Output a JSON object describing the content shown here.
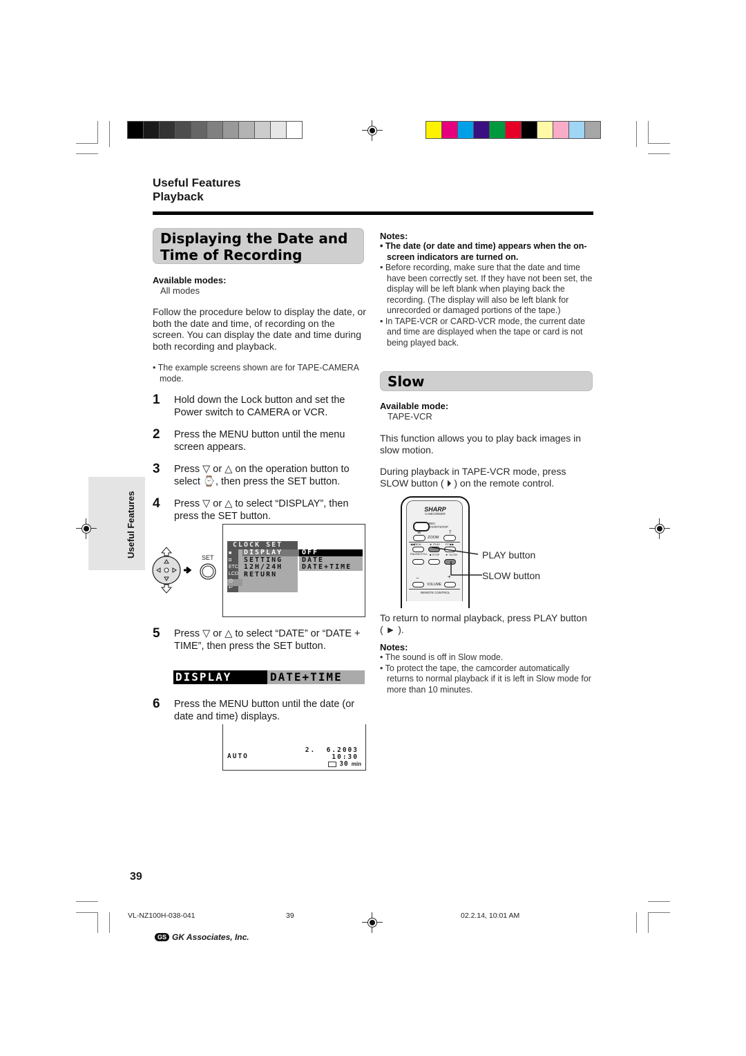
{
  "header": {
    "grayscale_swatches": [
      "#000000",
      "#1a1a1a",
      "#333333",
      "#4d4d4d",
      "#666666",
      "#808080",
      "#999999",
      "#b3b3b3",
      "#cccccc",
      "#e6e6e6",
      "#ffffff"
    ],
    "color_swatches": [
      "#fff200",
      "#e6007e",
      "#00a0e9",
      "#3a0f82",
      "#009a3e",
      "#e60027",
      "#000000",
      "#fff9a8",
      "#f7adc8",
      "#9fd5f5",
      "#a6a6a6"
    ]
  },
  "breadcrumb": {
    "line1": "Useful Features",
    "line2": "Playback"
  },
  "section1": {
    "title_line1": "Displaying the Date and",
    "title_line2": "Time of Recording",
    "available_label": "Available modes:",
    "available_value": "All modes",
    "intro": "Follow the procedure below to display the date, or both the date and time, of recording on the screen. You can display the date and time during both recording and playback.",
    "note": "• The example screens shown are for TAPE-CAMERA mode.",
    "steps": [
      {
        "num": "1",
        "text": "Hold down the Lock button and set the Power switch to CAMERA or VCR."
      },
      {
        "num": "2",
        "text": "Press the MENU button until the menu screen appears."
      },
      {
        "num": "3",
        "text": "Press ▽ or △ on the operation button to select ⌚, then press the SET button."
      },
      {
        "num": "4",
        "text": "Press ▽ or △ to select “DISPLAY”, then press the SET button."
      },
      {
        "num": "5",
        "text": "Press ▽ or △ to select “DATE” or “DATE + TIME”, then press the SET button."
      },
      {
        "num": "6",
        "text": "Press the MENU button until the date (or date and time) displays."
      }
    ],
    "set_label": "SET",
    "menu_screen": {
      "header": "CLOCK SET",
      "side_icons": [
        "camera-icon",
        "card-camera-icon",
        "ETC",
        "LCD",
        "clock-icon",
        "return-icon"
      ],
      "items": [
        "DISPLAY",
        "SETTING",
        "12H/24H",
        "RETURN"
      ],
      "options": [
        "OFF",
        "DATE",
        "DATE+TIME"
      ],
      "selected_option": "OFF"
    },
    "display_bar": {
      "left": "DISPLAY",
      "right": "DATE+TIME"
    },
    "playback_screen": {
      "mode": "AUTO",
      "date": "2.  6.2003",
      "time": "10:30",
      "remaining": "30",
      "remaining_unit": "min"
    }
  },
  "section2_notes": {
    "label": "Notes:",
    "items": [
      "The date (or date and time) appears when the on-screen indicators are turned on.",
      "Before recording, make sure that the date and time have been correctly set. If they have not been set, the display will be left blank when playing back the recording. (The display will also be left blank for unrecorded or damaged portions of the tape.)",
      "In TAPE-VCR or CARD-VCR mode, the current date and time are displayed when the tape or card is not being played back."
    ]
  },
  "slow": {
    "title": "Slow",
    "available_label": "Available mode:",
    "available_value": "TAPE-VCR",
    "intro": "This function allows you to play back images in slow motion.",
    "instruction": "During playback in TAPE-VCR mode, press SLOW button ( ⏵ ) on the remote control.",
    "remote": {
      "brand": "SHARP",
      "model": "CAMCORDER",
      "rec": "REC START/STOP",
      "w": "W",
      "t": "T",
      "zoom": "ZOOM",
      "rew": "◀◀REW",
      "play": "► PLAY",
      "ff": "FF ▶▶",
      "pause": "PAUSE/STILL",
      "stop": "■ STOP",
      "slow": "► SLOW",
      "minus": "−",
      "plus": "+",
      "volume": "VOLUME",
      "footer": "REMOTE CONTROL"
    },
    "play_callout": "PLAY button",
    "slow_callout": "SLOW button",
    "return_text": "To return to normal playback, press PLAY button ( ► ).",
    "notes_label": "Notes:",
    "notes": [
      "The sound is off in Slow mode.",
      "To protect the tape, the camcorder automatically returns to normal playback if it is left in Slow mode for more than 10 minutes."
    ]
  },
  "side_tab": "Useful Features",
  "page_number": "39",
  "footer": {
    "file": "VL-NZ100H-038-041",
    "page": "39",
    "date": "02.2.14, 10:01 AM",
    "company": "GK Associates, Inc.",
    "logo": "GS"
  }
}
